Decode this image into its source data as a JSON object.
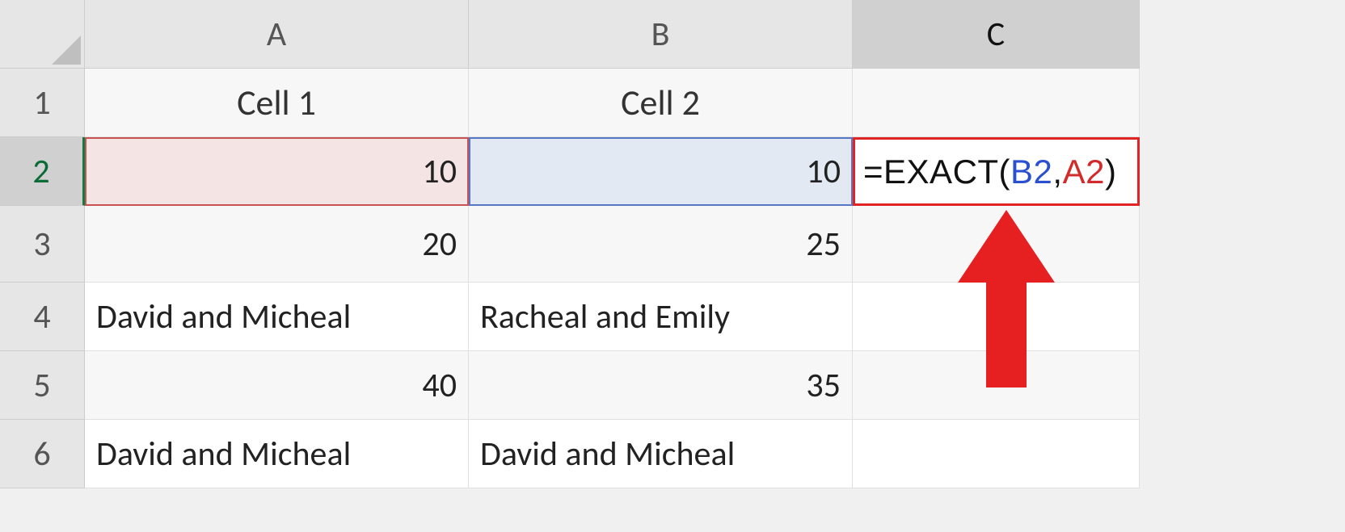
{
  "columns": {
    "a": "A",
    "b": "B",
    "c": "C"
  },
  "rows": {
    "r1": "1",
    "r2": "2",
    "r3": "3",
    "r4": "4",
    "r5": "5",
    "r6": "6"
  },
  "headers": {
    "col1": "Cell 1",
    "col2": "Cell 2"
  },
  "cells": {
    "a2": "10",
    "b2": "10",
    "a3": "20",
    "b3": "25",
    "a4": "David and Micheal",
    "b4": "Racheal and Emily",
    "a5": "40",
    "b5": "35",
    "a6": "David and Micheal",
    "b6": "David and Micheal"
  },
  "formula": {
    "prefix": "=EXACT(",
    "ref1": "B2",
    "sep": ",",
    "ref2": "A2",
    "suffix": ")"
  },
  "annotation": {
    "arrow": "red-arrow-up"
  },
  "chart_data": {
    "type": "table",
    "title": "",
    "columns": [
      "Cell 1",
      "Cell 2"
    ],
    "rows": [
      [
        "10",
        "10"
      ],
      [
        "20",
        "25"
      ],
      [
        "David and Micheal",
        "Racheal and Emily"
      ],
      [
        "40",
        "35"
      ],
      [
        "David and Micheal",
        "David and Micheal"
      ]
    ],
    "formula_cell": {
      "address": "C2",
      "text": "=EXACT(B2,A2)"
    }
  }
}
